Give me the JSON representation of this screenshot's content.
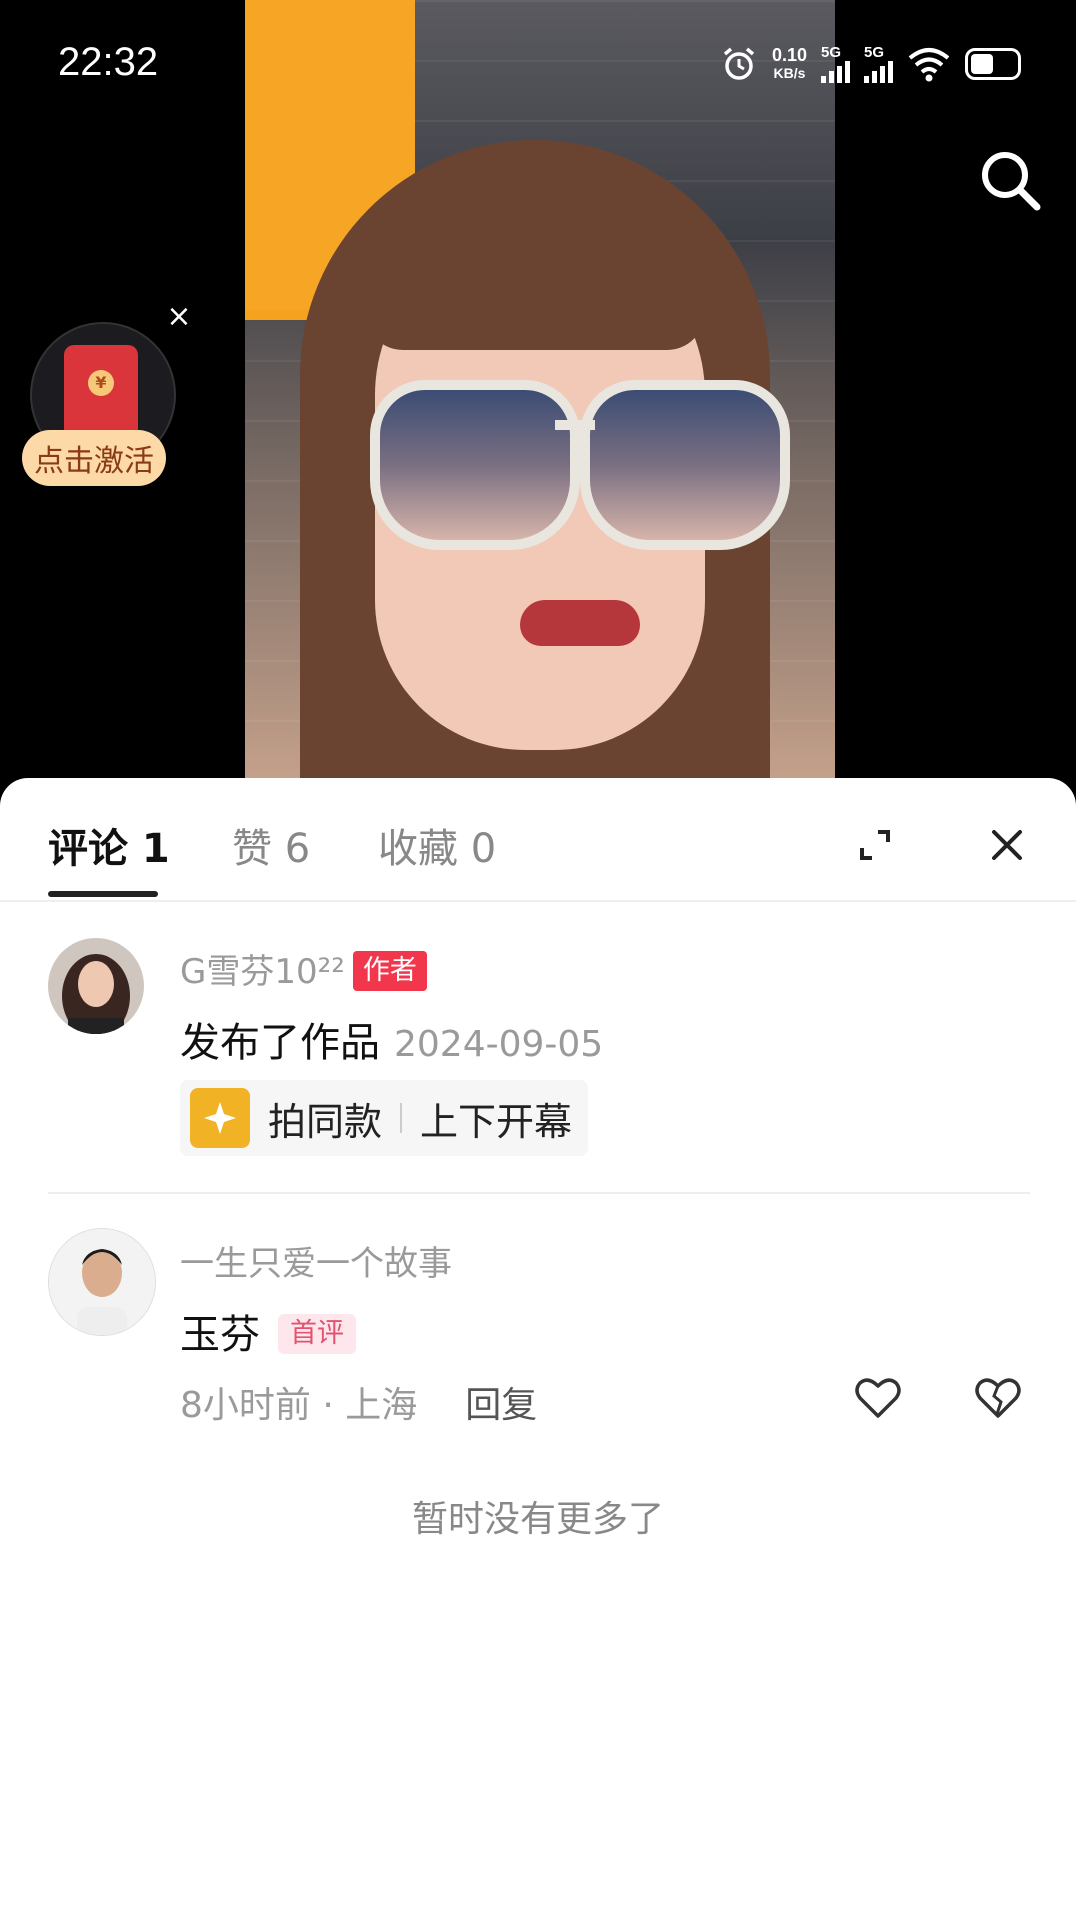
{
  "status_bar": {
    "time": "22:32",
    "net_speed_value": "0.10",
    "net_speed_unit": "KB/s",
    "sim1": "5G",
    "sim2": "5G"
  },
  "icons": {
    "search": "search-icon",
    "alarm": "alarm-icon",
    "wifi": "wifi-icon",
    "battery": "battery-icon",
    "expand": "expand-icon",
    "close": "close-icon",
    "sparkle": "sparkle-icon",
    "like": "heart-icon",
    "dislike": "broken-heart-icon"
  },
  "promo": {
    "label": "点击激活",
    "coin": "¥",
    "close": "×"
  },
  "tabs": [
    {
      "label": "评论 1",
      "active": true
    },
    {
      "label": "赞 6",
      "active": false
    },
    {
      "label": "收藏 0",
      "active": false
    }
  ],
  "author_post": {
    "username": "G雪芬10²²",
    "badge": "作者",
    "action": "发布了作品",
    "date": "2024-09-05",
    "same_style_label": "拍同款",
    "effect_name": "上下开幕"
  },
  "comment": {
    "username": "一生只爱一个故事",
    "text": "玉芬",
    "badge": "首评",
    "time_location": "8小时前 · 上海",
    "reply_label": "回复"
  },
  "footer": "暂时没有更多了",
  "colors": {
    "author_badge": "#f2374c",
    "first_badge_bg": "#fde7ec",
    "first_badge_text": "#e45271",
    "promo_bg": "#fdd9a8"
  }
}
